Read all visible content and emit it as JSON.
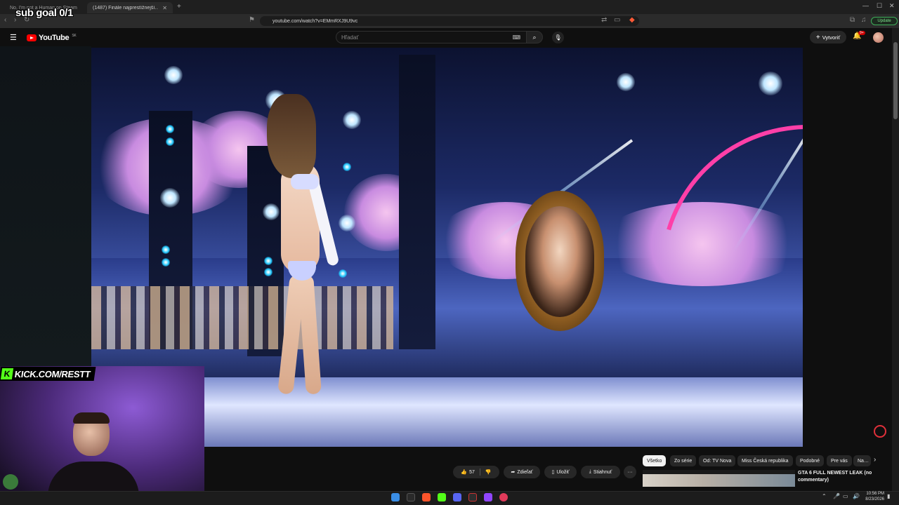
{
  "browser": {
    "tabs": [
      {
        "title": "No, I'm not a Human on Steam",
        "active": false
      },
      {
        "title": "(1487) Finále najprestížnejší…",
        "active": true
      }
    ],
    "new_tab_symbol": "+",
    "url": "youtube.com/watch?v=EMmRXJ9U9vc",
    "update_label": "Update"
  },
  "overlay": {
    "sub_goal": "sub goal 0/1",
    "kick_text": "KICK.COM/RESTT",
    "kick_letter": "K"
  },
  "youtube": {
    "logo_text": "YouTube",
    "region": "SK",
    "search_placeholder": "Hľadať",
    "create_label": "Vytvoriť",
    "notif_badge": "9+"
  },
  "actions": {
    "like_count": "57",
    "share_label": "Zdieľať",
    "save_label": "Uložiť",
    "download_label": "Stiahnuť",
    "more_symbol": "···"
  },
  "chips": [
    {
      "label": "Všetko",
      "active": true
    },
    {
      "label": "Zo série",
      "active": false
    },
    {
      "label": "Od: TV Nova",
      "active": false
    },
    {
      "label": "Miss Česká republika",
      "active": false
    },
    {
      "label": "Podobné",
      "active": false
    },
    {
      "label": "Pre vás",
      "active": false
    },
    {
      "label": "Na…",
      "active": false
    }
  ],
  "recommendation": {
    "title": "GTA 6 FULL NEWEST LEAK (no commentary)"
  },
  "taskbar": {
    "time": "10:56 PM",
    "date": "8/23/2026"
  },
  "colors": {
    "yt_red": "#ff0000",
    "kick_green": "#53fc18",
    "update_green": "#3fae5a",
    "bg": "#0f0f0f"
  }
}
